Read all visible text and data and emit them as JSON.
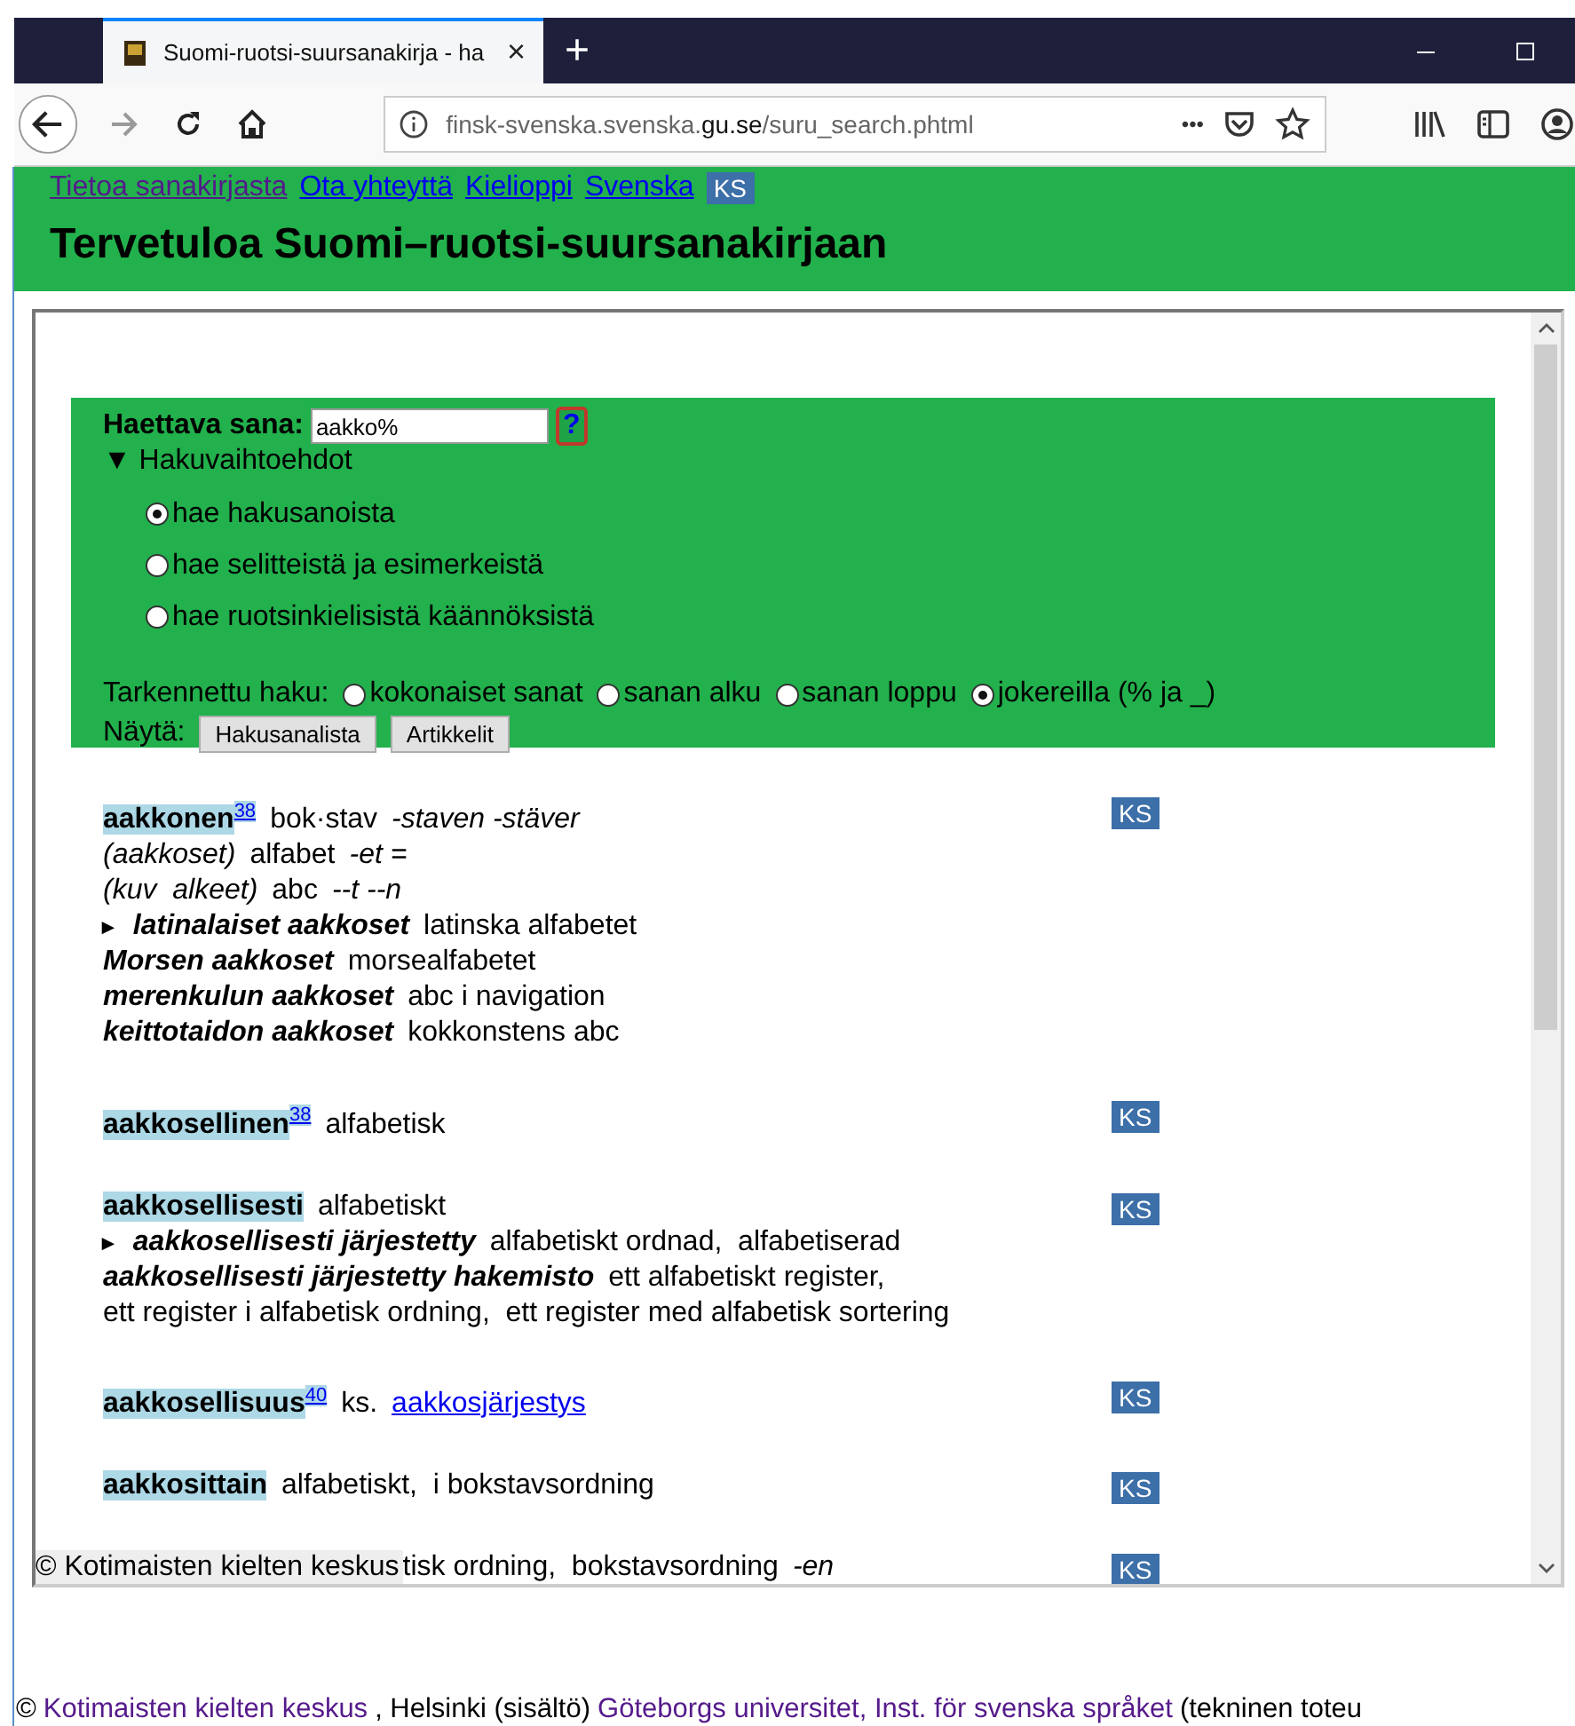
{
  "browser": {
    "tab": {
      "title": "Suomi-ruotsi-suursanakirja - ha",
      "close": "×"
    },
    "new_tab": "+",
    "url": {
      "prefix": "finsk-svenska.svenska.",
      "domain": "gu.se",
      "path": "/suru_search.phtml"
    },
    "page_actions": "•••"
  },
  "nav": [
    {
      "label": "Tietoa sanakirjasta",
      "visited": true
    },
    {
      "label": "Ota yhteyttä",
      "visited": false
    },
    {
      "label": "Kielioppi",
      "visited": false
    },
    {
      "label": "Svenska",
      "visited": false
    }
  ],
  "nav_badge": "KS",
  "title": "Tervetuloa Suomi–ruotsi-suursanakirjaan",
  "search": {
    "label": "Haettava sana:",
    "value": "aakko%",
    "help": "?",
    "options_toggle": {
      "marker": "▼",
      "label": "Hakuvaihtoehdot",
      "expanded": true
    },
    "scope": [
      {
        "label": "hae hakusanoista",
        "selected": true
      },
      {
        "label": "hae selitteistä ja esimerkeistä",
        "selected": false
      },
      {
        "label": "hae ruotsinkielisistä käännöksistä",
        "selected": false
      }
    ],
    "refine_label": "Tarkennettu haku:",
    "refine": [
      {
        "label": "kokonaiset sanat",
        "selected": false
      },
      {
        "label": "sanan alku",
        "selected": false
      },
      {
        "label": "sanan loppu",
        "selected": false
      },
      {
        "label": "jokereilla (% ja _)",
        "selected": true
      }
    ],
    "show_label": "Näytä:",
    "buttons": [
      "Hakusanalista",
      "Artikkelit"
    ]
  },
  "entries": [
    {
      "headword": "aakkonen",
      "sup": "38",
      "badge": "KS",
      "lines": [
        [
          {
            "kind": "text",
            "text": "bok·stav"
          },
          {
            "kind": "gram",
            "text": "-staven -stäver"
          }
        ],
        [
          {
            "kind": "gram",
            "text": "(aakkoset)"
          },
          {
            "kind": "text",
            "text": "alfabet"
          },
          {
            "kind": "gram",
            "text": "-et ="
          }
        ],
        [
          {
            "kind": "gram",
            "text": "(kuv  alkeet)"
          },
          {
            "kind": "text",
            "text": "abc"
          },
          {
            "kind": "gram",
            "text": "--t --n"
          }
        ],
        [
          {
            "kind": "marker",
            "text": "►"
          },
          {
            "kind": "phrase",
            "text": "latinalaiset aakkoset"
          },
          {
            "kind": "text",
            "text": "latinska alfabetet"
          }
        ],
        [
          {
            "kind": "phrase",
            "text": "Morsen aakkoset"
          },
          {
            "kind": "text",
            "text": "morsealfabetet"
          }
        ],
        [
          {
            "kind": "phrase",
            "text": "merenkulun aakkoset"
          },
          {
            "kind": "text",
            "text": "abc i navigation"
          }
        ],
        [
          {
            "kind": "phrase",
            "text": "keittotaidon aakkoset"
          },
          {
            "kind": "text",
            "text": "kokkonstens abc"
          }
        ]
      ]
    },
    {
      "headword": "aakkosellinen",
      "sup": "38",
      "badge": "KS",
      "lines": [
        [
          {
            "kind": "text",
            "text": "alfabetisk"
          }
        ]
      ]
    },
    {
      "headword": "aakkosellisesti",
      "badge": "KS",
      "lines": [
        [
          {
            "kind": "text",
            "text": "alfabetiskt"
          }
        ],
        [
          {
            "kind": "marker",
            "text": "►"
          },
          {
            "kind": "phrase",
            "text": "aakkosellisesti järjestetty"
          },
          {
            "kind": "text",
            "text": "alfabetiskt ordnad,  alfabetiserad"
          }
        ],
        [
          {
            "kind": "phrase",
            "text": "aakkosellisesti järjestetty hakemisto"
          },
          {
            "kind": "text",
            "text": "ett alfabetiskt register,"
          }
        ],
        [
          {
            "kind": "text",
            "text": "ett register i alfabetisk ordning,  ett register med alfabetisk sortering"
          }
        ]
      ]
    },
    {
      "headword": "aakkosellisuus",
      "sup": "40",
      "badge": "KS",
      "lines": [
        [
          {
            "kind": "text",
            "text": "ks."
          },
          {
            "kind": "link",
            "text": "aakkosjärjestys"
          }
        ]
      ]
    },
    {
      "headword": "aakkosittain",
      "badge": "KS",
      "lines": [
        [
          {
            "kind": "text",
            "text": "alfabetiskt,  i bokstavsordning"
          }
        ]
      ]
    }
  ],
  "partial_entry": {
    "badge": "KS",
    "lines": [
      [
        {
          "kind": "text",
          "text": "tisk ordning,  bokstavsordning"
        },
        {
          "kind": "gram",
          "text": "-en"
        }
      ]
    ]
  },
  "frame_copyright": "© Kotimaisten kielten keskus",
  "footer": [
    {
      "kind": "text",
      "text": "©"
    },
    {
      "kind": "link",
      "text": "Kotimaisten kielten keskus"
    },
    {
      "kind": "text",
      "text": ", Helsinki (sisältö)"
    },
    {
      "kind": "link",
      "text": "Göteborgs universitet, Inst. för svenska språket"
    },
    {
      "kind": "text",
      "text": "(tekninen toteu"
    }
  ]
}
